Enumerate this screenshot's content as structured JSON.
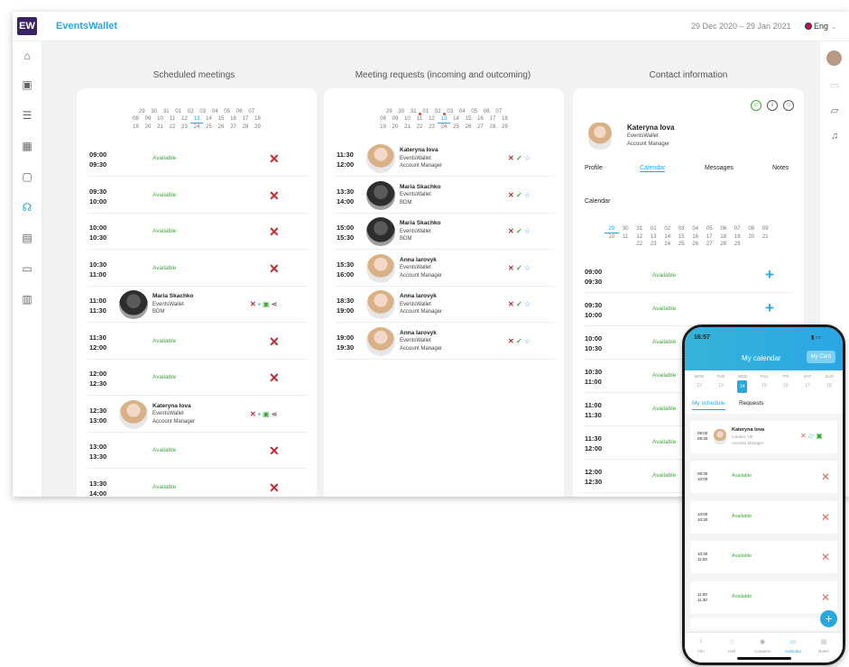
{
  "app": {
    "brand": "EventsWallet",
    "logo": "EW",
    "date_range": "29 Dec 2020 – 29 Jan 2021",
    "language": "Eng"
  },
  "sidebar_icons": [
    "home-icon",
    "badge-icon",
    "list-icon",
    "grid-icon",
    "contacts-icon",
    "meetings-icon",
    "exhibitors-icon",
    "document-icon",
    "stats-icon"
  ],
  "rightbar_icons": [
    "calendar-icon",
    "chat-icon",
    "bell-icon"
  ],
  "scheduled": {
    "title": "Scheduled meetings",
    "cal_rows": [
      [
        "29",
        "30",
        "31",
        "01",
        "02",
        "03",
        "04",
        "05",
        "06",
        "07"
      ],
      [
        "08",
        "09",
        "10",
        "11",
        "12",
        "13",
        "14",
        "15",
        "16",
        "17",
        "18"
      ],
      [
        "19",
        "20",
        "21",
        "22",
        "23",
        "24",
        "25",
        "26",
        "27",
        "28",
        "29"
      ]
    ],
    "today": "13",
    "rows": [
      {
        "t1": "09:00",
        "t2": "09:30",
        "status": "Available"
      },
      {
        "t1": "09:30",
        "t2": "10:00",
        "status": "Available"
      },
      {
        "t1": "10:00",
        "t2": "10:30",
        "status": "Available"
      },
      {
        "t1": "10:30",
        "t2": "11:00",
        "status": "Available"
      },
      {
        "t1": "11:00",
        "t2": "11:30",
        "name": "Maria Skachko",
        "company": "EventsWallet",
        "role": "BDM",
        "avatar": "m"
      },
      {
        "t1": "11:30",
        "t2": "12:00",
        "status": "Available"
      },
      {
        "t1": "12:00",
        "t2": "12:30",
        "status": "Available"
      },
      {
        "t1": "12:30",
        "t2": "13:00",
        "name": "Kateryna Iova",
        "company": "EventsWallet",
        "role": "Account Manager",
        "avatar": "f"
      },
      {
        "t1": "13:00",
        "t2": "13:30",
        "status": "Available"
      },
      {
        "t1": "13:30",
        "t2": "14:00",
        "status": "Available"
      }
    ]
  },
  "requests": {
    "title": "Meeting requests (incoming and outcoming)",
    "cal_rows": [
      [
        "29",
        "30",
        "31",
        "01",
        "02",
        "03",
        "04",
        "05",
        "06",
        "07"
      ],
      [
        "08",
        "09",
        "10",
        "11",
        "12",
        "13",
        "14",
        "15",
        "16",
        "17",
        "18"
      ],
      [
        "19",
        "20",
        "21",
        "22",
        "23",
        "24",
        "25",
        "26",
        "27",
        "28",
        "29"
      ]
    ],
    "today": "13",
    "dots": [
      "11",
      "13"
    ],
    "rows": [
      {
        "t1": "11:30",
        "t2": "12:00",
        "name": "Kateryna Iova",
        "company": "EventsWallet",
        "role": "Account Manager",
        "avatar": "f"
      },
      {
        "t1": "13:30",
        "t2": "14:00",
        "name": "Maria Skachko",
        "company": "EventsWallet",
        "role": "BDM",
        "avatar": "m"
      },
      {
        "t1": "15:00",
        "t2": "15:30",
        "name": "Maria Skachko",
        "company": "EventsWallet",
        "role": "BDM",
        "avatar": "m"
      },
      {
        "t1": "15:30",
        "t2": "16:00",
        "name": "Anna Iarovyk",
        "company": "EventsWallet",
        "role": "Account Manager",
        "avatar": "f"
      },
      {
        "t1": "18:30",
        "t2": "19:00",
        "name": "Anna Iarovyk",
        "company": "EventsWallet",
        "role": "Account Manager",
        "avatar": "f"
      },
      {
        "t1": "19:00",
        "t2": "19:30",
        "name": "Anna Iarovyk",
        "company": "EventsWallet",
        "role": "Account Manager",
        "avatar": "f"
      }
    ]
  },
  "contact": {
    "title": "Contact information",
    "name": "Kateryna Iova",
    "company": "EventsWallet",
    "role": "Account Manager",
    "tabs": [
      "Profile",
      "Calendar",
      "Messages",
      "Notes"
    ],
    "active_tab": "Calendar",
    "calendar_label": "Calendar",
    "cal_rows": [
      [
        "29",
        "30",
        "31",
        "01",
        "02",
        "03",
        "04",
        "05",
        "06",
        "07",
        "08",
        "09"
      ],
      [
        "10",
        "11",
        "12",
        "13",
        "14",
        "15",
        "16",
        "17",
        "18",
        "19",
        "20",
        "21"
      ],
      [
        "22",
        "23",
        "24",
        "25",
        "26",
        "27",
        "28",
        "29"
      ]
    ],
    "today": "29",
    "rows": [
      {
        "t1": "09:00",
        "t2": "09:30",
        "status": "Available"
      },
      {
        "t1": "09:30",
        "t2": "10:00",
        "status": "Available"
      },
      {
        "t1": "10:00",
        "t2": "10:30",
        "status": "Available"
      },
      {
        "t1": "10:30",
        "t2": "11:00",
        "status": "Available"
      },
      {
        "t1": "11:00",
        "t2": "11:30",
        "status": "Available"
      },
      {
        "t1": "11:30",
        "t2": "12:00",
        "status": "Available"
      },
      {
        "t1": "12:00",
        "t2": "12:30",
        "status": "Available"
      }
    ]
  },
  "phone": {
    "status_time": "16:57",
    "title": "My calendar",
    "card_button": "My Card",
    "weekdays": [
      "MON",
      "TUE",
      "WED",
      "THU",
      "FRI",
      "SAT",
      "SUN"
    ],
    "days": [
      "12",
      "13",
      "14",
      "15",
      "16",
      "17",
      "18"
    ],
    "selected_day": "14",
    "tabs": [
      "My schedule",
      "Requests"
    ],
    "meeting": {
      "t1": "09:00",
      "t2": "09:30",
      "name": "Kateryna Iova",
      "location": "London, UK",
      "role": "Account Manager"
    },
    "rows": [
      {
        "t1": "09:30",
        "t2": "10:00",
        "status": "Available"
      },
      {
        "t1": "10:00",
        "t2": "10:30",
        "status": "Available"
      },
      {
        "t1": "10:30",
        "t2": "11:00",
        "status": "Available"
      },
      {
        "t1": "11:00",
        "t2": "11:30",
        "status": "Available"
      }
    ],
    "nav": [
      "Info",
      "Hall",
      "Contacts",
      "Calendar",
      "Notes"
    ],
    "active_nav": "Calendar"
  },
  "colors": {
    "accent": "#29a8e0",
    "available": "#3aaa35",
    "decline": "#c0272d"
  }
}
